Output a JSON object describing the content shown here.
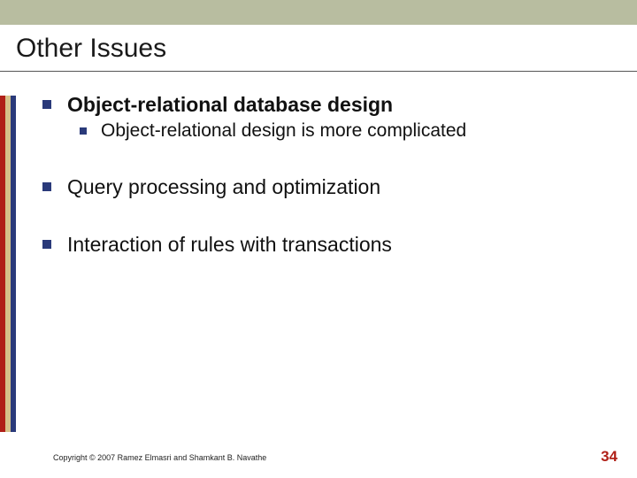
{
  "title": "Other Issues",
  "bullets": {
    "item1": "Object-relational database design",
    "item1_sub": "Object-relational design is more complicated",
    "item2": "Query processing and optimization",
    "item3": "Interaction of rules with transactions"
  },
  "footer": {
    "copyright": "Copyright © 2007 Ramez Elmasri and Shamkant B. Navathe",
    "page": "34"
  }
}
